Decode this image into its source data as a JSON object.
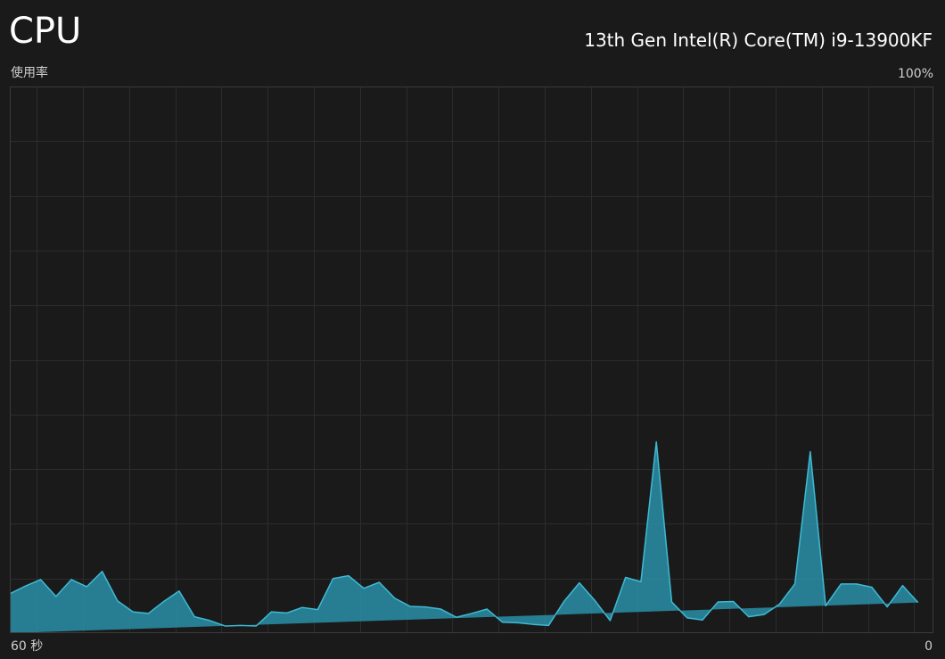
{
  "header": {
    "title": "CPU",
    "processor_name": "13th Gen Intel(R) Core(TM) i9-13900KF"
  },
  "graph": {
    "y_label": "使用率",
    "y_max_label": "100%",
    "x_left_label": "60 秒",
    "x_right_label": "0"
  },
  "colors": {
    "background": "#1a1a1a",
    "grid": "#2c2c2c",
    "border": "#3a3a3a",
    "fill": "#2a91a8",
    "line": "#3fb9d3"
  },
  "chart_data": {
    "type": "area",
    "ylim": [
      0,
      100
    ],
    "xlim": [
      60,
      0
    ],
    "grid": true,
    "x": [
      60,
      59,
      58,
      57,
      56,
      55,
      54,
      53,
      52,
      51,
      50,
      49,
      48,
      47,
      46,
      45,
      44,
      43,
      42,
      41,
      40,
      39,
      38,
      37,
      36,
      35,
      34,
      33,
      32,
      31,
      30,
      29,
      28,
      27,
      26,
      25,
      24,
      23,
      22,
      21,
      20,
      19,
      18,
      17,
      16,
      15,
      14,
      13,
      12,
      11,
      10,
      9,
      8,
      7,
      6,
      5,
      4,
      3,
      2,
      1,
      0
    ],
    "values": [
      7.2,
      8.6,
      9.8,
      6.7,
      9.8,
      8.5,
      11.3,
      5.9,
      3.9,
      3.6,
      5.8,
      7.7,
      3.0,
      2.3,
      1.3,
      1.4,
      1.3,
      3.9,
      3.7,
      4.7,
      4.3,
      10.0,
      10.5,
      8.2,
      9.3,
      6.4,
      4.9,
      4.8,
      4.4,
      2.9,
      3.6,
      4.4,
      2.0,
      1.9,
      1.6,
      1.4,
      5.8,
      9.2,
      6.0,
      2.3,
      10.2,
      9.4,
      35.0,
      5.7,
      2.8,
      2.4,
      5.7,
      5.8,
      3.0,
      3.4,
      5.3,
      9.0,
      33.2,
      5.0,
      9.0,
      9.0,
      8.4,
      4.8,
      8.7,
      5.6
    ]
  }
}
